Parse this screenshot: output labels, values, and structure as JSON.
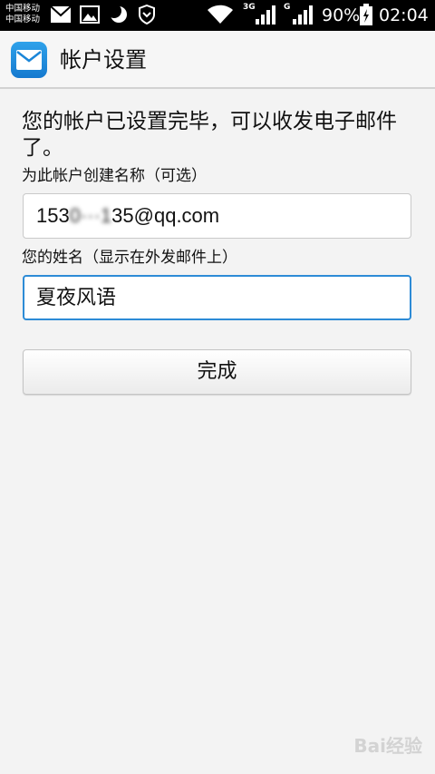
{
  "status_bar": {
    "carrier_1": "中国移动",
    "carrier_2": "中国移动",
    "net_3g": "3G",
    "net_g": "G",
    "battery": "90%",
    "time": "02:04",
    "icons": [
      "mail-icon",
      "image-icon",
      "moon-icon",
      "shield-icon",
      "wifi-icon",
      "signal-icon",
      "battery-icon"
    ]
  },
  "app_bar": {
    "icon": "mail-app-icon",
    "title": "帐户设置"
  },
  "main": {
    "message": "您的帐户已设置完毕，可以收发电子邮件了。",
    "account_name": {
      "label": "为此帐户创建名称（可选）",
      "value_prefix": "153",
      "value_blurred": "0···1",
      "value_suffix": "35@qq.com"
    },
    "your_name": {
      "label": "您的姓名（显示在外发邮件上）",
      "value": "夏夜风语"
    },
    "done_button": "完成"
  },
  "watermark": "Bai经验",
  "colors": {
    "status_bar_bg": "#000000",
    "app_bar_bg": "#f6f6f6",
    "page_bg": "#f3f3f3",
    "focus_border": "#2d8bd6",
    "app_icon_blue": "#1e8fe0"
  }
}
